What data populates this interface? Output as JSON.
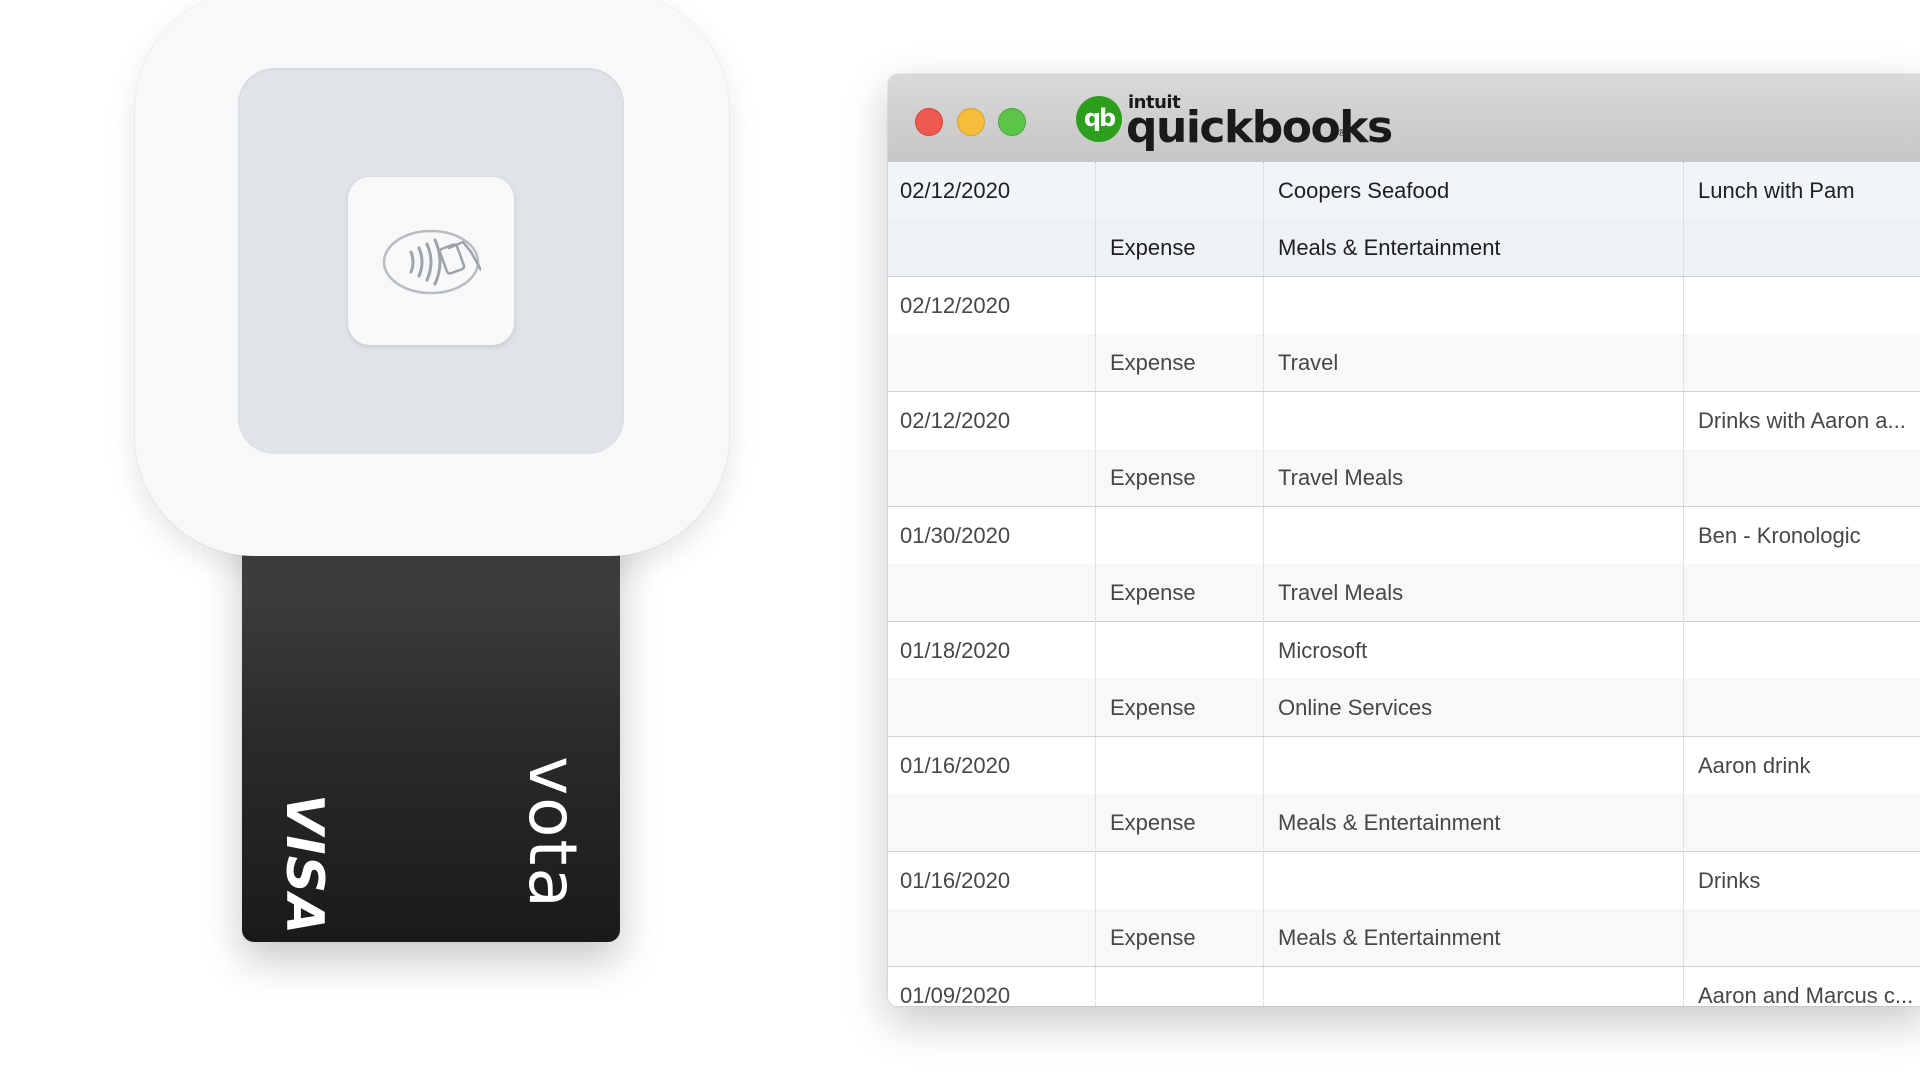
{
  "card": {
    "network": "VISA",
    "brand": "vota"
  },
  "window": {
    "logo_mark": "qb",
    "logo_intuit": "intuit",
    "logo_word": "quickbooks",
    "logo_reg": "®"
  },
  "transactions": [
    {
      "date": "02/12/2020",
      "type": "Expense",
      "payee": "Coopers Seafood",
      "category": "Meals & Entertainment",
      "memo": "Lunch with Pam"
    },
    {
      "date": "02/12/2020",
      "type": "Expense",
      "payee": "",
      "category": "Travel",
      "memo": ""
    },
    {
      "date": "02/12/2020",
      "type": "Expense",
      "payee": "",
      "category": "Travel Meals",
      "memo": "Drinks with Aaron a..."
    },
    {
      "date": "01/30/2020",
      "type": "Expense",
      "payee": "",
      "category": "Travel Meals",
      "memo": "Ben - Kronologic"
    },
    {
      "date": "01/18/2020",
      "type": "Expense",
      "payee": "Microsoft",
      "category": "Online Services",
      "memo": ""
    },
    {
      "date": "01/16/2020",
      "type": "Expense",
      "payee": "",
      "category": "Meals & Entertainment",
      "memo": "Aaron drink"
    },
    {
      "date": "01/16/2020",
      "type": "Expense",
      "payee": "",
      "category": "Meals & Entertainment",
      "memo": "Drinks"
    },
    {
      "date": "01/09/2020",
      "type": "",
      "payee": "",
      "category": "",
      "memo": "Aaron and Marcus c..."
    }
  ],
  "colors": {
    "qb_green": "#2ca01c",
    "traffic_close": "#ee5a52",
    "traffic_min": "#f5bd3a",
    "traffic_max": "#5bc548"
  }
}
